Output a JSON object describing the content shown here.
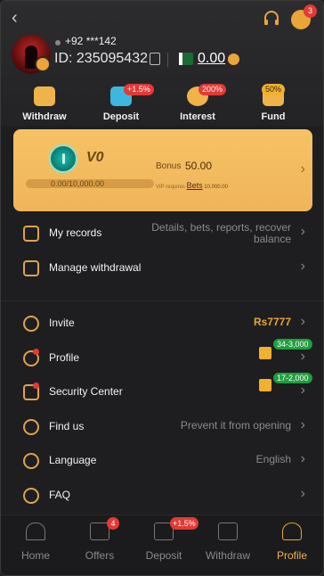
{
  "header": {
    "back_icon": "chevron-left-icon",
    "support_icon": "headset-icon",
    "messages_icon": "message-icon",
    "messages_badge": "3"
  },
  "profile": {
    "phone": "+92 ***142",
    "uid_prefix": "ID:",
    "uid": "235095432",
    "balance": "0.00"
  },
  "quick_actions": [
    {
      "label": "Withdraw",
      "icon": "withdraw-icon",
      "tag": ""
    },
    {
      "label": "Deposit",
      "icon": "deposit-icon",
      "tag": "+1.5%"
    },
    {
      "label": "Interest",
      "icon": "interest-icon",
      "tag": "200%"
    },
    {
      "label": "Fund",
      "icon": "fund-icon",
      "tag": "50%"
    }
  ],
  "vip": {
    "level": "V0",
    "progress": "0.00/10,000.00",
    "progress_fraction": 0,
    "bonus_label": "Bonus",
    "bonus_value": "50.00",
    "requirement_prefix": "VIP requires",
    "requirement_link": "Bets",
    "requirement_amount": "10,000.00"
  },
  "records": [
    {
      "label": "My records",
      "hint_line1": "Details, bets, reports, recover",
      "hint_line2": "balance",
      "icon": "records-icon"
    },
    {
      "label": "Manage withdrawal",
      "hint_line1": "",
      "hint_line2": "",
      "icon": "withdrawal-card-icon"
    }
  ],
  "menu": [
    {
      "label": "Invite",
      "hint": "Rs7777",
      "icon": "invite-icon",
      "tag": ""
    },
    {
      "label": "Profile",
      "hint": "",
      "icon": "profile-icon",
      "tag": "34-3,000"
    },
    {
      "label": "Security Center",
      "hint": "",
      "icon": "shield-icon",
      "tag": "17-2,000"
    },
    {
      "label": "Find us",
      "hint": "Prevent it from opening",
      "icon": "find-us-icon",
      "tag": ""
    },
    {
      "label": "Language",
      "hint": "English",
      "icon": "globe-icon",
      "tag": ""
    },
    {
      "label": "FAQ",
      "hint": "",
      "icon": "question-icon",
      "tag": ""
    }
  ],
  "tabs": [
    {
      "label": "Home",
      "icon": "home-icon",
      "badge": ""
    },
    {
      "label": "Offers",
      "icon": "gift-icon",
      "badge": "4"
    },
    {
      "label": "Deposit",
      "icon": "wallet-icon",
      "badge": "+1.5%"
    },
    {
      "label": "Withdraw",
      "icon": "ticket-icon",
      "badge": ""
    },
    {
      "label": "Profile",
      "icon": "user-icon",
      "badge": "",
      "active": true
    }
  ],
  "colors": {
    "accent": "#f0b34a",
    "badge_red": "#e53935",
    "tag_green": "#1e9f3e",
    "vip_card": "#f3bb5f"
  }
}
